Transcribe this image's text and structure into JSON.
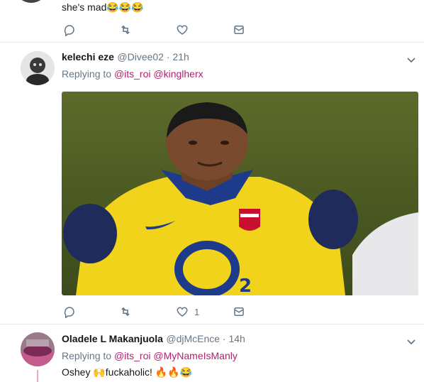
{
  "tweet1": {
    "text": "she's mad😂😂😂",
    "actions": {
      "reply_count": "",
      "retweet_count": "",
      "like_count": ""
    }
  },
  "tweet2": {
    "name": "kelechi eze",
    "handle": "@Divee02 · 21h",
    "replying_prefix": "Replying to",
    "replying_1": "@its_roi",
    "replying_2": "@kinglherx",
    "image": {
      "jersey_sponsor": "O2",
      "jersey_color": "#f2d31b"
    },
    "actions": {
      "reply_count": "",
      "retweet_count": "",
      "like_count": "1"
    }
  },
  "tweet3": {
    "name": "Oladele L Makanjuola",
    "handle": "@djMcEnce · 14h",
    "replying_prefix": "Replying to",
    "replying_1": "@its_roi",
    "replying_2": "@MyNameIsManly",
    "text": "Oshey 🙌fuckaholic! 🔥🔥😂"
  },
  "colors": {
    "link": "#b0216f",
    "muted": "#657786",
    "separator": "#e6ecf0"
  }
}
